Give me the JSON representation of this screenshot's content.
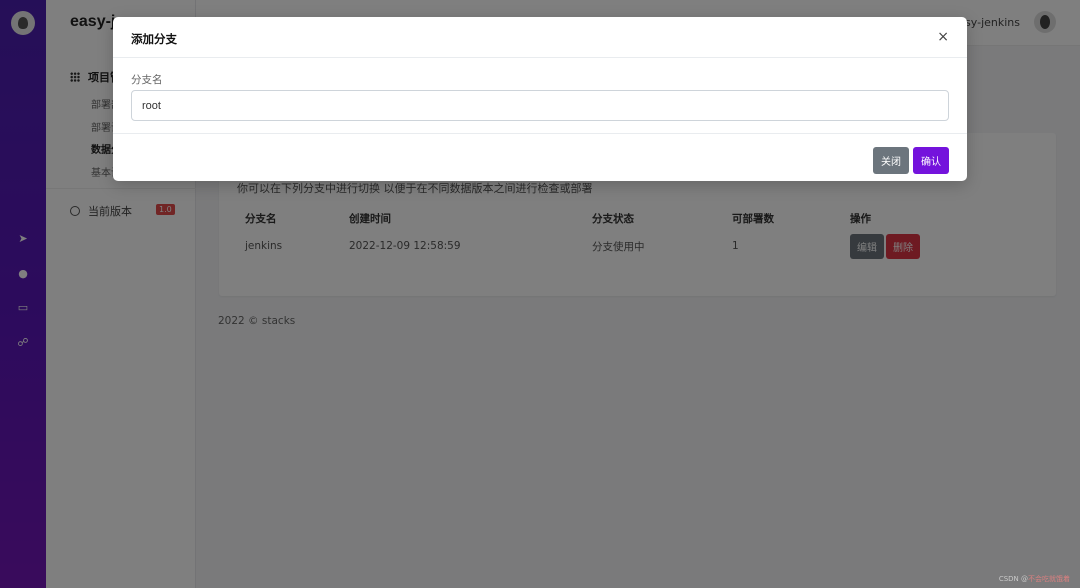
{
  "app": {
    "brand": "easy-je"
  },
  "topbar": {
    "user_name": "easy-jenkins"
  },
  "sidebar": {
    "group_label": "项目管",
    "items": [
      {
        "label": "部署部"
      },
      {
        "label": "部署设"
      },
      {
        "label": "数据分"
      },
      {
        "label": "基本设"
      }
    ],
    "version_label": "当前版本",
    "version_badge": "1.0"
  },
  "main": {
    "description": "你可以在下列分支中进行切换 以便于在不同数据版本之间进行检查或部署",
    "table": {
      "headers": [
        "分支名",
        "创建时间",
        "分支状态",
        "可部署数",
        "操作"
      ],
      "rows": [
        {
          "name": "jenkins",
          "created": "2022-12-09 12:58:59",
          "status": "分支使用中",
          "count": "1"
        }
      ],
      "edit_label": "编辑",
      "delete_label": "删除"
    },
    "footer": "2022 © stacks"
  },
  "modal": {
    "title": "添加分支",
    "close_symbol": "×",
    "field_label": "分支名",
    "field_value": "root",
    "cancel_label": "关闭",
    "confirm_label": "确认"
  },
  "watermark": {
    "text": "CSDN @",
    "red_text": "不会吃就饿着"
  },
  "colors": {
    "accent": "#7413dc",
    "rail": "#5a16ba",
    "danger": "#dc3545",
    "secondary": "#6c757d"
  }
}
